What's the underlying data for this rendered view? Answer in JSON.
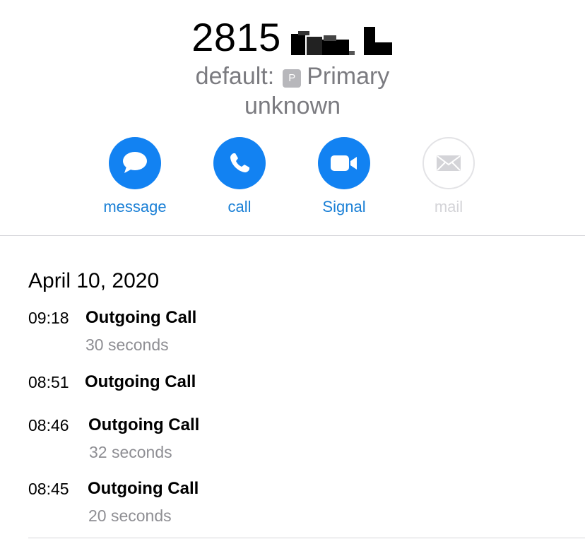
{
  "header": {
    "number": "2815",
    "label_prefix": "default:",
    "label_badge": "P",
    "label_name": "Primary",
    "status": "unknown"
  },
  "actions": [
    {
      "label": "message",
      "icon": "message-bubble-icon",
      "enabled": true
    },
    {
      "label": "call",
      "icon": "phone-icon",
      "enabled": true
    },
    {
      "label": "Signal",
      "icon": "video-camera-icon",
      "enabled": true
    },
    {
      "label": "mail",
      "icon": "envelope-icon",
      "enabled": false
    }
  ],
  "history": {
    "date": "April 10, 2020",
    "entries": [
      {
        "time": "09:18",
        "type": "Outgoing Call",
        "duration": "30 seconds"
      },
      {
        "time": "08:51",
        "type": "Outgoing Call",
        "duration": ""
      },
      {
        "time": "08:46",
        "type": "Outgoing Call",
        "duration": "32 seconds"
      },
      {
        "time": "08:45",
        "type": "Outgoing Call",
        "duration": "20 seconds"
      }
    ]
  },
  "colors": {
    "accent": "#1282f2",
    "link": "#1b80d6",
    "secondary_text": "#7b7b80",
    "disabled": "#d4d4d8"
  }
}
